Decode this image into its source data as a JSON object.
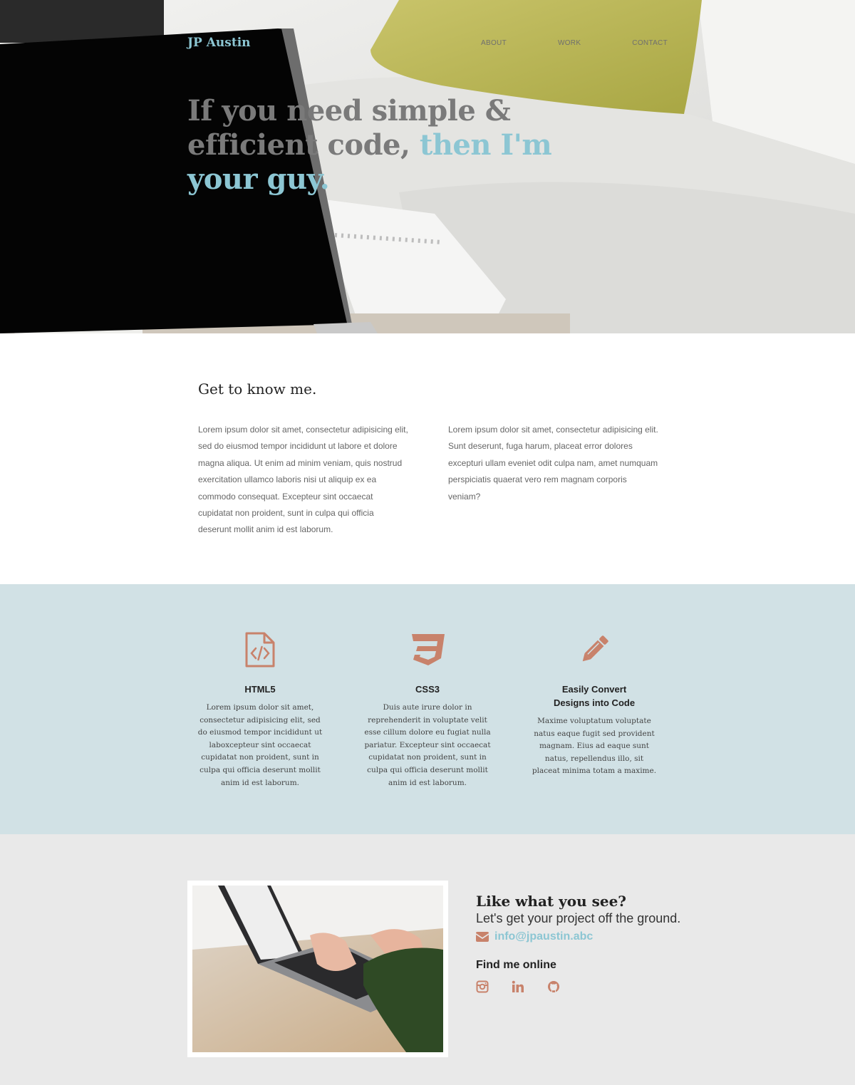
{
  "colors": {
    "accent": "#8cc6d3",
    "icon": "#c8826b",
    "features_bg": "#d1e1e5",
    "contact_bg": "#e9e9e9"
  },
  "header": {
    "logo": "JP Austin",
    "nav": [
      "ABOUT",
      "WORK",
      "CONTACT"
    ]
  },
  "hero": {
    "headline_main": "If you need simple & efficient code,",
    "headline_accent": "then I'm your guy."
  },
  "about": {
    "title": "Get to know me.",
    "col1": "Lorem ipsum dolor sit amet, consectetur adipisicing elit, sed do eiusmod tempor incididunt ut labore et dolore magna aliqua. Ut enim ad minim veniam, quis nostrud exercitation ullamco laboris nisi ut aliquip ex ea commodo consequat. Excepteur sint occaecat cupidatat non proident, sunt in culpa qui officia deserunt mollit anim id est laborum.",
    "col2": "Lorem ipsum dolor sit amet, consectetur adipisicing elit. Sunt deserunt, fuga harum, placeat error dolores excepturi ullam eveniet odit culpa nam, amet numquam perspiciatis quaerat vero rem magnam corporis veniam?"
  },
  "features": [
    {
      "icon": "file-code-icon",
      "title": "HTML5",
      "text": "Lorem ipsum dolor sit amet, consectetur adipisicing elit, sed do eiusmod tempor incididunt ut laboxcepteur sint occaecat cupidatat non proident, sunt in culpa qui officia deserunt mollit anim id est laborum."
    },
    {
      "icon": "css3-icon",
      "title": "CSS3",
      "text": "Duis aute irure dolor in reprehenderit in voluptate velit esse cillum dolore eu fugiat nulla pariatur. Excepteur sint occaecat cupidatat non proident, sunt in culpa qui officia deserunt mollit anim id est laborum."
    },
    {
      "icon": "pencil-icon",
      "title_line1": "Easily Convert",
      "title_line2": "Designs into Code",
      "text": "Maxime voluptatum voluptate natus eaque fugit sed provident magnam. Eius ad eaque sunt natus, repellendus illo, sit placeat minima totam a maxime."
    }
  ],
  "contact": {
    "title": "Like what you see?",
    "subtitle": "Let's get your project off the ground.",
    "email": "info@jpaustin.abc",
    "find_title": "Find me online",
    "social": [
      "instagram-icon",
      "linkedin-icon",
      "github-icon"
    ]
  }
}
